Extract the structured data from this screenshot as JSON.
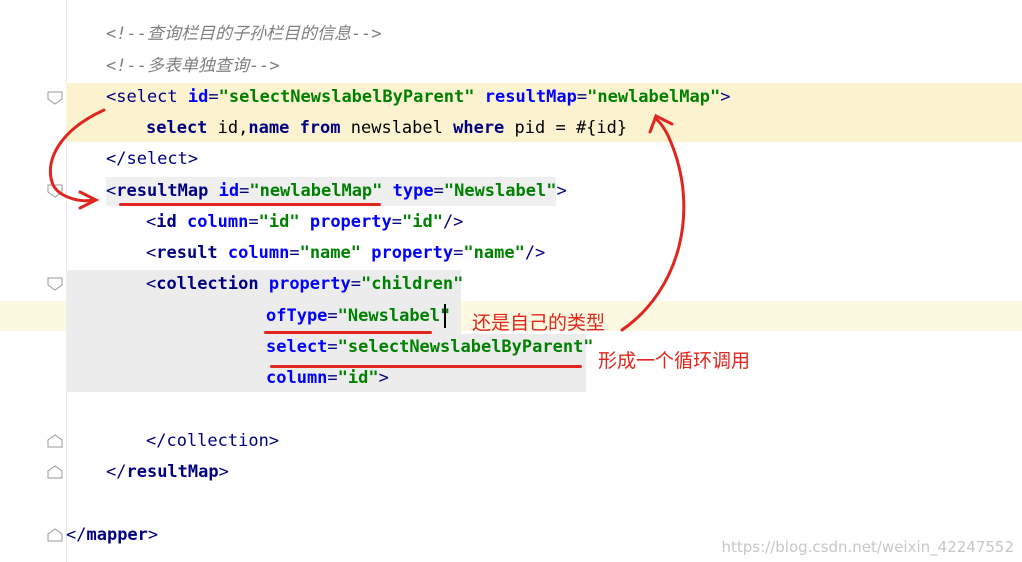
{
  "editor": {
    "lines": [
      {
        "id": "l1",
        "parts": [
          {
            "c": "t-comment",
            "t": "<!--查询栏目的子孙栏目的信息-->"
          }
        ]
      },
      {
        "id": "l2",
        "parts": [
          {
            "c": "t-comment",
            "t": "<!--多表单独查询-->"
          }
        ]
      },
      {
        "id": "l3",
        "parts": [
          {
            "c": "t-tag",
            "t": "<select "
          },
          {
            "c": "t-attr",
            "t": "id"
          },
          {
            "c": "t-tag",
            "t": "="
          },
          {
            "c": "t-val",
            "t": "\"selectNewslabelByParent\""
          },
          {
            "c": "t-tag",
            "t": " "
          },
          {
            "c": "t-attr",
            "t": "resultMap"
          },
          {
            "c": "t-tag",
            "t": "="
          },
          {
            "c": "t-val",
            "t": "\"newlabelMap\""
          },
          {
            "c": "t-tag",
            "t": ">"
          }
        ]
      },
      {
        "id": "l4",
        "parts": [
          {
            "c": "t-kw",
            "t": "select "
          },
          {
            "c": "t-plain",
            "t": "id,"
          },
          {
            "c": "t-kw",
            "t": "name "
          },
          {
            "c": "t-kw",
            "t": "from "
          },
          {
            "c": "t-plain",
            "t": "newslabel "
          },
          {
            "c": "t-kw",
            "t": "where "
          },
          {
            "c": "t-plain",
            "t": "pid = #{id}"
          }
        ]
      },
      {
        "id": "l5",
        "parts": [
          {
            "c": "t-tag",
            "t": "</select>"
          }
        ]
      },
      {
        "id": "l6",
        "parts": [
          {
            "c": "t-tag",
            "t": "<"
          },
          {
            "c": "t-kw",
            "t": "resultMap "
          },
          {
            "c": "t-attr",
            "t": "id"
          },
          {
            "c": "t-tag",
            "t": "="
          },
          {
            "c": "t-val",
            "t": "\"newlabelMap\""
          },
          {
            "c": "t-tag",
            "t": " "
          },
          {
            "c": "t-attr",
            "t": "type"
          },
          {
            "c": "t-tag",
            "t": "="
          },
          {
            "c": "t-val",
            "t": "\"Newslabel\""
          },
          {
            "c": "t-tag",
            "t": ">"
          }
        ]
      },
      {
        "id": "l7",
        "parts": [
          {
            "c": "t-tag",
            "t": "<"
          },
          {
            "c": "t-kw",
            "t": "id "
          },
          {
            "c": "t-attr",
            "t": "column"
          },
          {
            "c": "t-tag",
            "t": "="
          },
          {
            "c": "t-val",
            "t": "\"id\""
          },
          {
            "c": "t-tag",
            "t": " "
          },
          {
            "c": "t-attr",
            "t": "property"
          },
          {
            "c": "t-tag",
            "t": "="
          },
          {
            "c": "t-val",
            "t": "\"id\""
          },
          {
            "c": "t-tag",
            "t": "/>"
          }
        ]
      },
      {
        "id": "l8",
        "parts": [
          {
            "c": "t-tag",
            "t": "<"
          },
          {
            "c": "t-kw",
            "t": "result "
          },
          {
            "c": "t-attr",
            "t": "column"
          },
          {
            "c": "t-tag",
            "t": "="
          },
          {
            "c": "t-val",
            "t": "\"name\""
          },
          {
            "c": "t-tag",
            "t": " "
          },
          {
            "c": "t-attr",
            "t": "property"
          },
          {
            "c": "t-tag",
            "t": "="
          },
          {
            "c": "t-val",
            "t": "\"name\""
          },
          {
            "c": "t-tag",
            "t": "/>"
          }
        ]
      },
      {
        "id": "l9",
        "parts": [
          {
            "c": "t-tag",
            "t": "<"
          },
          {
            "c": "t-kw",
            "t": "collection "
          },
          {
            "c": "t-attr",
            "t": "property"
          },
          {
            "c": "t-tag",
            "t": "="
          },
          {
            "c": "t-val",
            "t": "\"children\""
          }
        ]
      },
      {
        "id": "l10",
        "parts": [
          {
            "c": "t-attr",
            "t": "ofType"
          },
          {
            "c": "t-tag",
            "t": "="
          },
          {
            "c": "t-val",
            "t": "\"Newslabel\""
          }
        ]
      },
      {
        "id": "l11",
        "parts": [
          {
            "c": "t-attr",
            "t": "select"
          },
          {
            "c": "t-tag",
            "t": "="
          },
          {
            "c": "t-val",
            "t": "\"selectNewslabelByParent\""
          }
        ]
      },
      {
        "id": "l12",
        "parts": [
          {
            "c": "t-attr",
            "t": "column"
          },
          {
            "c": "t-tag",
            "t": "="
          },
          {
            "c": "t-val",
            "t": "\"id\""
          },
          {
            "c": "t-tag",
            "t": ">"
          }
        ]
      },
      {
        "id": "l13",
        "parts": [
          {
            "c": "t-tag",
            "t": "</collection>"
          }
        ]
      },
      {
        "id": "l14",
        "parts": [
          {
            "c": "t-tag",
            "t": "</"
          },
          {
            "c": "t-kw",
            "t": "resultMap"
          },
          {
            "c": "t-tag",
            "t": ">"
          }
        ]
      },
      {
        "id": "l15",
        "parts": [
          {
            "c": "t-tag",
            "t": "</"
          },
          {
            "c": "t-kw",
            "t": "mapper"
          },
          {
            "c": "t-tag",
            "t": ">"
          }
        ]
      }
    ]
  },
  "annotations": {
    "note1": "还是自己的类型",
    "note2": "形成一个循环调用"
  },
  "watermark": "https://blog.csdn.net/weixin_42247552",
  "colors": {
    "highlight": "#fbf3d0",
    "annotation": "#e0261e"
  }
}
